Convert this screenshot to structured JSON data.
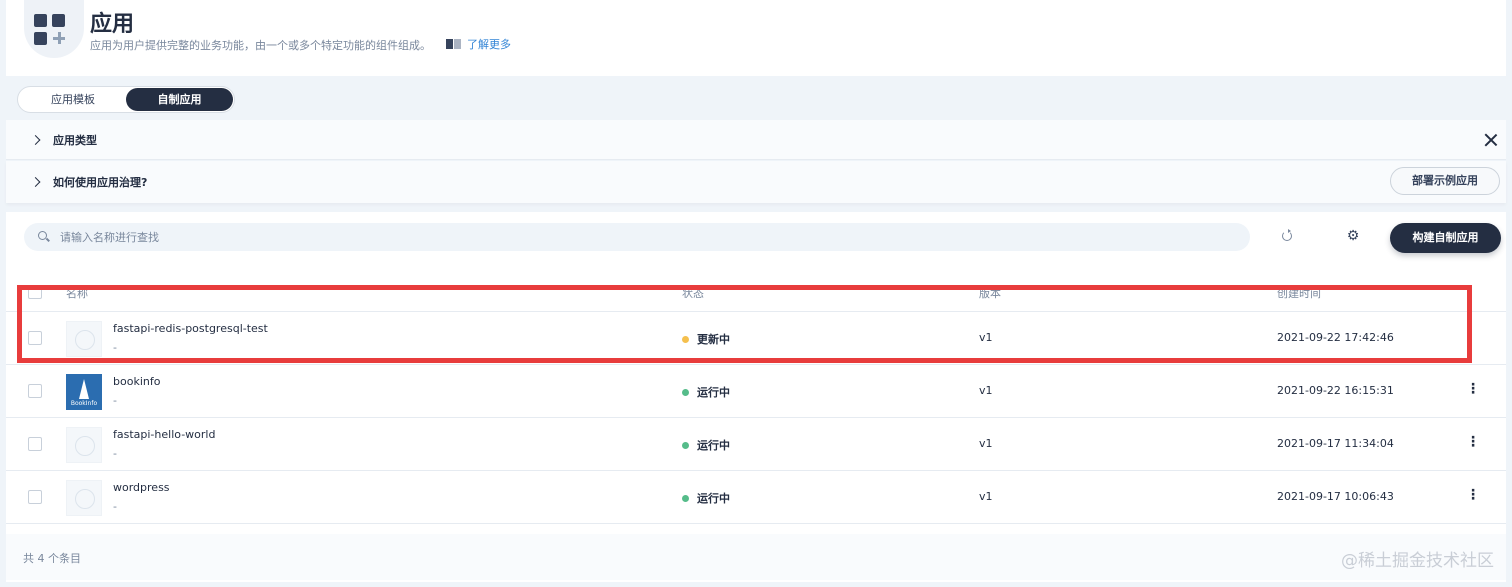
{
  "header": {
    "title": "应用",
    "description": "应用为用户提供完整的业务功能，由一个或多个特定功能的组件组成。",
    "learn_more": "了解更多"
  },
  "tabs": [
    {
      "label": "应用模板",
      "active": false
    },
    {
      "label": "自制应用",
      "active": true
    }
  ],
  "info_panels": {
    "app_types": "应用类型",
    "how_to": "如何使用应用治理?",
    "deploy_sample_button": "部署示例应用"
  },
  "toolbar": {
    "search_placeholder": "请输入名称进行查找",
    "build_button": "构建自制应用"
  },
  "table": {
    "columns": [
      "名称",
      "状态",
      "版本",
      "创建时间"
    ],
    "rows": [
      {
        "name": "fastapi-redis-postgresql-test",
        "desc": "-",
        "status": "更新中",
        "status_color": "#f5c04e",
        "version": "v1",
        "created": "2021-09-22 17:42:46",
        "icon": "default-app-icon"
      },
      {
        "name": "bookinfo",
        "desc": "-",
        "status": "运行中",
        "status_color": "#55bc8a",
        "version": "v1",
        "created": "2021-09-22 16:15:31",
        "icon": "bookinfo-icon",
        "icon_text": "BookInfo"
      },
      {
        "name": "fastapi-hello-world",
        "desc": "-",
        "status": "运行中",
        "status_color": "#55bc8a",
        "version": "v1",
        "created": "2021-09-17 11:34:04",
        "icon": "default-app-icon"
      },
      {
        "name": "wordpress",
        "desc": "-",
        "status": "运行中",
        "status_color": "#55bc8a",
        "version": "v1",
        "created": "2021-09-17 10:06:43",
        "icon": "default-app-icon"
      }
    ]
  },
  "footer": {
    "total": "共 4 个条目"
  },
  "watermark": "@稀土掘金技术社区",
  "colors": {
    "primary_dark": "#242e42",
    "highlight_border": "#e83c3c",
    "running": "#55bc8a",
    "updating": "#f5c04e"
  }
}
